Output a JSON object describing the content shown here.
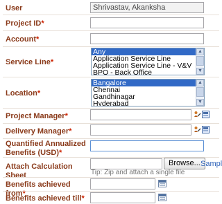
{
  "user": {
    "label": "User",
    "value": "Shrivastav, Akanksha"
  },
  "project_id": {
    "label": "Project ID",
    "required": "*",
    "value": ""
  },
  "account": {
    "label": "Account",
    "required": "*",
    "value": ""
  },
  "service_line": {
    "label": "Service Line",
    "required": "*",
    "options": [
      "Any",
      "Application Service Line",
      "Application Service Line - V&V",
      "BPO - Back Office"
    ],
    "selected": "Any"
  },
  "location": {
    "label": "Location",
    "required": "*",
    "options": [
      "Bangalore",
      "Chennai",
      "Gandhinagar",
      "Hyderabad"
    ],
    "selected": "Bangalore"
  },
  "project_manager": {
    "label": "Project Manager",
    "required": "*",
    "value": ""
  },
  "delivery_manager": {
    "label": "Delivery Manager",
    "required": "*",
    "value": ""
  },
  "benefits": {
    "label_line1": "Quantified Annualized",
    "label_line2": "Benefits (USD)",
    "required": "*",
    "value": ""
  },
  "attach": {
    "label": "Attach Calculation Sheet",
    "browse_label": "Browse...",
    "sample_label": "Sample",
    "tip": "Tip: Zip and attach a single file"
  },
  "benefits_from": {
    "label": "Benefits achieved from",
    "required": "*",
    "value": ""
  },
  "benefits_till": {
    "label": "Benefits achieved till",
    "required": "*",
    "value": ""
  },
  "icons": {
    "person_picker": "person-picker-icon",
    "address_book": "address-book-icon",
    "calendar": "calendar-icon"
  }
}
